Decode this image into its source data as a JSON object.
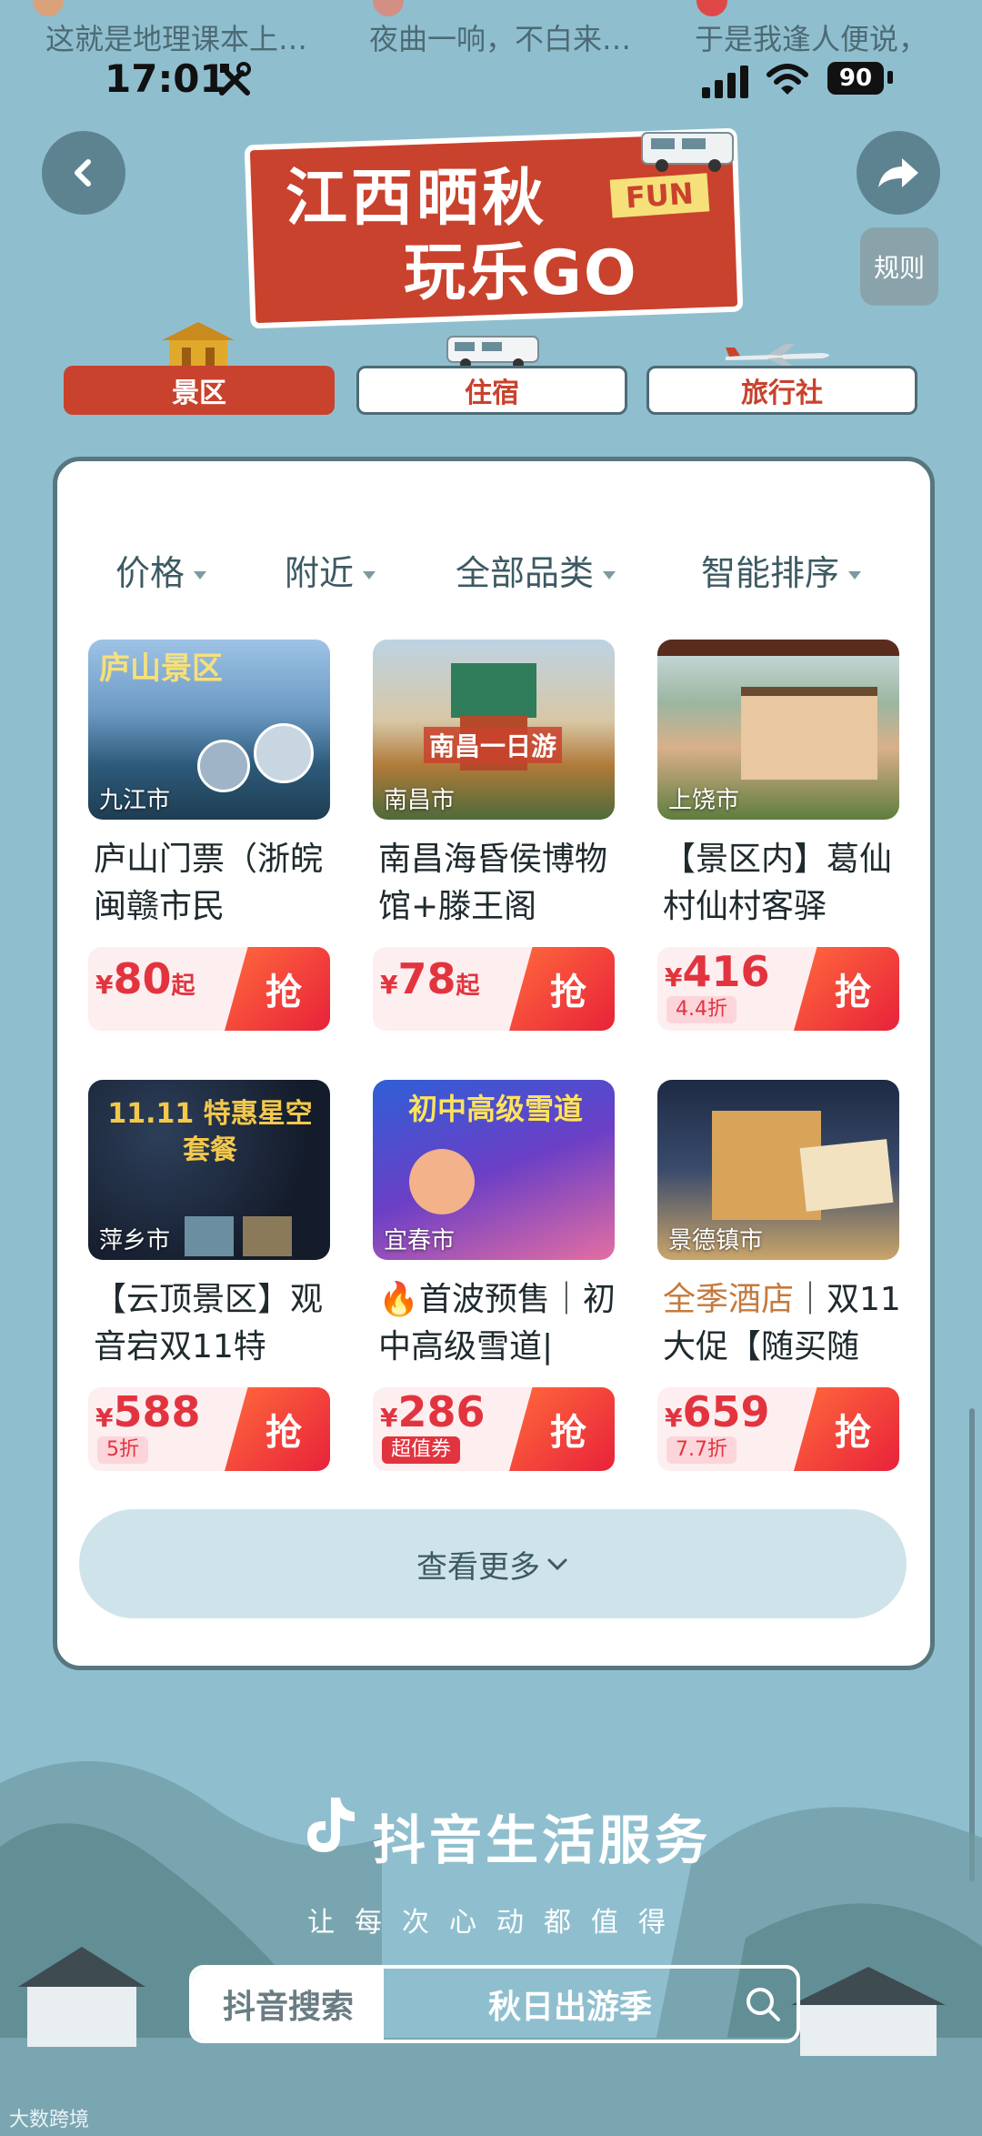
{
  "top_strip": {
    "items": [
      "这就是地理课本上…",
      "夜曲一响，不白来…",
      "于是我逢人便说，"
    ]
  },
  "status_bar": {
    "time": "17:01",
    "battery": "90"
  },
  "header": {
    "back_icon": "chevron-left-icon",
    "share_icon": "share-arrow-icon",
    "rules_label": "规则",
    "banner_line1": "江西晒秋",
    "banner_line2": "玩乐GO",
    "banner_tag": "FUN"
  },
  "tabs": [
    {
      "label": "景区",
      "active": true
    },
    {
      "label": "住宿",
      "active": false
    },
    {
      "label": "旅行社",
      "active": false
    }
  ],
  "filters": [
    {
      "label": "价格"
    },
    {
      "label": "附近"
    },
    {
      "label": "全部品类"
    },
    {
      "label": "智能排序"
    }
  ],
  "products": [
    {
      "city": "九江市",
      "title": "庐山门票（浙皖闽赣市民",
      "price_currency": "¥",
      "price": "80",
      "price_suffix": "起",
      "discount": "",
      "grab": "抢",
      "image_text": "庐山景区"
    },
    {
      "city": "南昌市",
      "title": "南昌海昏侯博物馆+滕王阁",
      "price_currency": "¥",
      "price": "78",
      "price_suffix": "起",
      "discount": "",
      "grab": "抢",
      "image_text": "南昌一日游"
    },
    {
      "city": "上饶市",
      "title": "【景区内】葛仙村仙村客驿",
      "price_currency": "¥",
      "price": "416",
      "price_suffix": "",
      "discount": "4.4折",
      "grab": "抢",
      "image_text": ""
    },
    {
      "city": "萍乡市",
      "title": "【云顶景区】观音宕双11特",
      "price_currency": "¥",
      "price": "588",
      "price_suffix": "",
      "discount": "5折",
      "grab": "抢",
      "image_text": "11.11 特惠星空套餐"
    },
    {
      "city": "宜春市",
      "title": "🔥首波预售｜初中高级雪道|",
      "price_currency": "¥",
      "price": "286",
      "price_suffix": "",
      "discount": "超值券",
      "grab": "抢",
      "image_text": "初中高级雪道"
    },
    {
      "city": "景德镇市",
      "brand": "全季酒店",
      "title": "｜双11大促【随买随",
      "price_currency": "¥",
      "price": "659",
      "price_suffix": "",
      "discount": "7.7折",
      "grab": "抢",
      "image_text": ""
    }
  ],
  "more_label": "查看更多",
  "footer": {
    "brand": "抖音生活服务",
    "slogan": "让每次心动都值得",
    "search_left": "抖音搜索",
    "search_query": "秋日出游季",
    "watermark": "大数跨境"
  },
  "colors": {
    "page_bg": "#8fbfcf",
    "accent_red": "#c9422d",
    "price_red": "#e2343f",
    "panel_border": "#58767f"
  }
}
